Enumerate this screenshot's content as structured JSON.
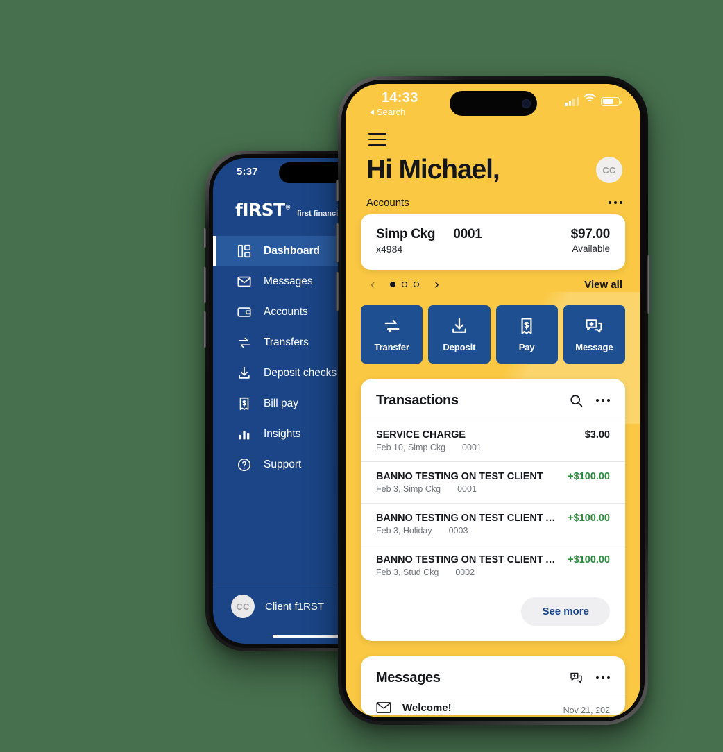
{
  "colors": {
    "background": "#47704E",
    "brand_yellow": "#FAC843",
    "brand_blue": "#1E4F91",
    "sidebar_blue": "#1B4586",
    "sidebar_active": "#2A5A9E",
    "credit_green": "#2E8B3D",
    "text_dark": "#14161A"
  },
  "back_phone": {
    "status": {
      "time": "5:37"
    },
    "logo": {
      "mark": "fIRST",
      "registered": "®",
      "tagline": "first financi"
    },
    "nav_items": [
      {
        "label": "Dashboard",
        "icon": "dashboard-icon",
        "active": true
      },
      {
        "label": "Messages",
        "icon": "envelope-icon",
        "active": false
      },
      {
        "label": "Accounts",
        "icon": "wallet-icon",
        "active": false
      },
      {
        "label": "Transfers",
        "icon": "transfer-arrows-icon",
        "active": false
      },
      {
        "label": "Deposit checks",
        "icon": "deposit-download-icon",
        "active": false
      },
      {
        "label": "Bill pay",
        "icon": "bill-receipt-icon",
        "active": false
      },
      {
        "label": "Insights",
        "icon": "bar-chart-icon",
        "active": false
      },
      {
        "label": "Support",
        "icon": "question-circle-icon",
        "active": false
      }
    ],
    "user": {
      "initials": "CC",
      "name": "Client f1RST"
    }
  },
  "front_phone": {
    "status": {
      "time": "14:33",
      "back_label": "Search",
      "signal_bars_filled": 2,
      "signal_bars_total": 4,
      "wifi": "wifi-icon",
      "battery": "battery-icon"
    },
    "header": {
      "menu": "hamburger-menu-icon",
      "greeting": "Hi Michael,",
      "avatar_initials": "CC"
    },
    "accounts_section": {
      "title": "Accounts",
      "overflow": "more-options-icon",
      "card": {
        "name": "Simp Ckg",
        "mask": "x4984",
        "number": "0001",
        "balance": "$97.00",
        "balance_label": "Available"
      },
      "carousel": {
        "prev": "‹",
        "next": "›",
        "total_dots": 3,
        "active_dot": 0
      },
      "view_all": "View all"
    },
    "quick_actions": [
      {
        "label": "Transfer",
        "icon": "transfer-arrows-icon"
      },
      {
        "label": "Deposit",
        "icon": "deposit-download-icon"
      },
      {
        "label": "Pay",
        "icon": "bill-receipt-icon"
      },
      {
        "label": "Message",
        "icon": "message-add-icon"
      }
    ],
    "transactions": {
      "title": "Transactions",
      "search_icon": "search-icon",
      "overflow_icon": "more-options-icon",
      "rows": [
        {
          "name": "SERVICE CHARGE",
          "date": "Feb 10, Simp Ckg",
          "account": "0001",
          "amount": "$3.00",
          "credit": false
        },
        {
          "name": "BANNO TESTING ON TEST CLIENT",
          "date": "Feb 3, Simp Ckg",
          "account": "0001",
          "amount": "+$100.00",
          "credit": true
        },
        {
          "name": "BANNO TESTING ON TEST CLIENT ACC...",
          "date": "Feb 3, Holiday",
          "account": "0003",
          "amount": "+$100.00",
          "credit": true
        },
        {
          "name": "BANNO TESTING ON TEST CLIENT ACC...",
          "date": "Feb 3, Stud Ckg",
          "account": "0002",
          "amount": "+$100.00",
          "credit": true
        }
      ],
      "see_more": "See more"
    },
    "messages": {
      "title": "Messages",
      "compose_icon": "message-add-icon",
      "overflow_icon": "more-options-icon",
      "rows": [
        {
          "title": "Welcome!",
          "date": "Nov 21, 202",
          "icon": "envelope-icon"
        }
      ]
    }
  }
}
